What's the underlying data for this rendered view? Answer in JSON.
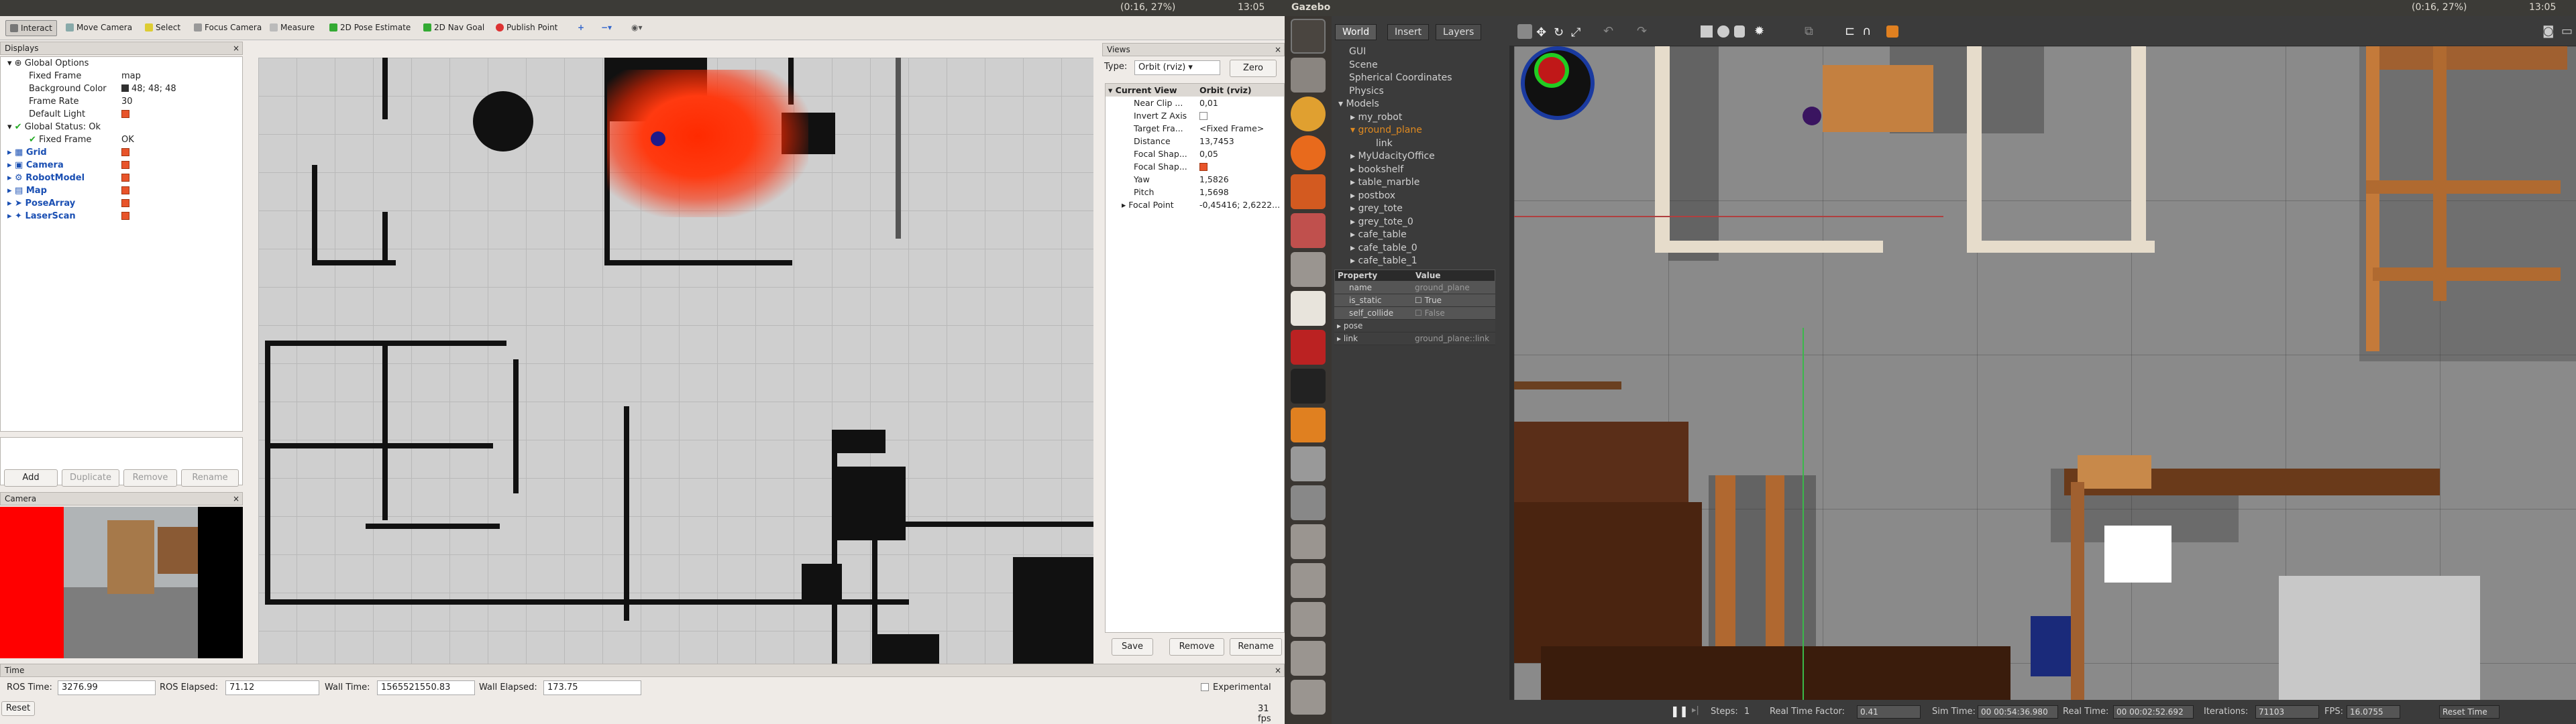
{
  "topbar": {
    "left_indicator": "(0:16, 27%)",
    "left_time": "13:05",
    "app": "Gazebo",
    "right_indicator": "(0:16, 27%)",
    "right_time": "13:05"
  },
  "rviz": {
    "toolbar": [
      "Interact",
      "Move Camera",
      "Select",
      "Focus Camera",
      "Measure",
      "2D Pose Estimate",
      "2D Nav Goal",
      "Publish Point"
    ],
    "displays": {
      "title": "Displays",
      "rows": [
        {
          "k": "Global Options",
          "v": ""
        },
        {
          "k": "Fixed Frame",
          "v": "map"
        },
        {
          "k": "Background Color",
          "v": "48; 48; 48"
        },
        {
          "k": "Frame Rate",
          "v": "30"
        },
        {
          "k": "Default Light",
          "v": ""
        },
        {
          "k": "Global Status: Ok",
          "v": ""
        },
        {
          "k": "Fixed Frame",
          "v": "OK"
        },
        {
          "k": "Grid",
          "v": ""
        },
        {
          "k": "Camera",
          "v": ""
        },
        {
          "k": "RobotModel",
          "v": ""
        },
        {
          "k": "Map",
          "v": ""
        },
        {
          "k": "PoseArray",
          "v": ""
        },
        {
          "k": "LaserScan",
          "v": ""
        }
      ],
      "add": "Add",
      "duplicate": "Duplicate",
      "remove": "Remove",
      "rename": "Rename"
    },
    "camera_title": "Camera",
    "views": {
      "title": "Views",
      "type_label": "Type:",
      "type_value": "Orbit (rviz)",
      "zero": "Zero",
      "head_k": "Current View",
      "head_v": "Orbit (rviz)",
      "rows": [
        {
          "k": "Near Clip ...",
          "v": "0,01"
        },
        {
          "k": "Invert Z Axis",
          "v": ""
        },
        {
          "k": "Target Fra...",
          "v": "<Fixed Frame>"
        },
        {
          "k": "Distance",
          "v": "13,7453"
        },
        {
          "k": "Focal Shap...",
          "v": "0,05"
        },
        {
          "k": "Focal Shap...",
          "v": ""
        },
        {
          "k": "Yaw",
          "v": "1,5826"
        },
        {
          "k": "Pitch",
          "v": "1,5698"
        },
        {
          "k": "Focal Point",
          "v": "-0,45416; 2,6222..."
        }
      ],
      "save": "Save",
      "remove": "Remove",
      "rename": "Rename"
    },
    "time": {
      "title": "Time",
      "ros_time_label": "ROS Time:",
      "ros_time": "3276.99",
      "ros_elapsed_label": "ROS Elapsed:",
      "ros_elapsed": "71.12",
      "wall_time_label": "Wall Time:",
      "wall_time": "1565521550.83",
      "wall_elapsed_label": "Wall Elapsed:",
      "wall_elapsed": "173.75",
      "experimental": "Experimental",
      "reset": "Reset",
      "fps": "31 fps"
    }
  },
  "gazebo": {
    "tabs": [
      "World",
      "Insert",
      "Layers"
    ],
    "tree": [
      "GUI",
      "Scene",
      "Spherical Coordinates",
      "Physics",
      "Models",
      "my_robot",
      "ground_plane",
      "link",
      "MyUdacityOffice",
      "bookshelf",
      "table_marble",
      "postbox",
      "grey_tote",
      "grey_tote_0",
      "cafe_table",
      "cafe_table_0",
      "cafe_table_1"
    ],
    "prop_header": {
      "k": "Property",
      "v": "Value"
    },
    "props": [
      {
        "k": "name",
        "v": "ground_plane"
      },
      {
        "k": "is_static",
        "v": "True"
      },
      {
        "k": "self_collide",
        "v": "False"
      },
      {
        "k": "pose",
        "v": ""
      },
      {
        "k": "link",
        "v": "ground_plane::link"
      }
    ],
    "bottom": {
      "steps_label": "Steps:",
      "steps": "1",
      "rtf_label": "Real Time Factor:",
      "rtf": "0.41",
      "sim_label": "Sim Time:",
      "sim": "00 00:54:36.980",
      "real_label": "Real Time:",
      "real": "00 00:02:52.692",
      "iter_label": "Iterations:",
      "iter": "71103",
      "fps_label": "FPS:",
      "fps": "16.0755",
      "reset": "Reset Time"
    }
  },
  "colors": {
    "accent": "#e8542a",
    "rviz_bg": "#efebe7",
    "gazebo_bg": "#3b3b3b"
  }
}
